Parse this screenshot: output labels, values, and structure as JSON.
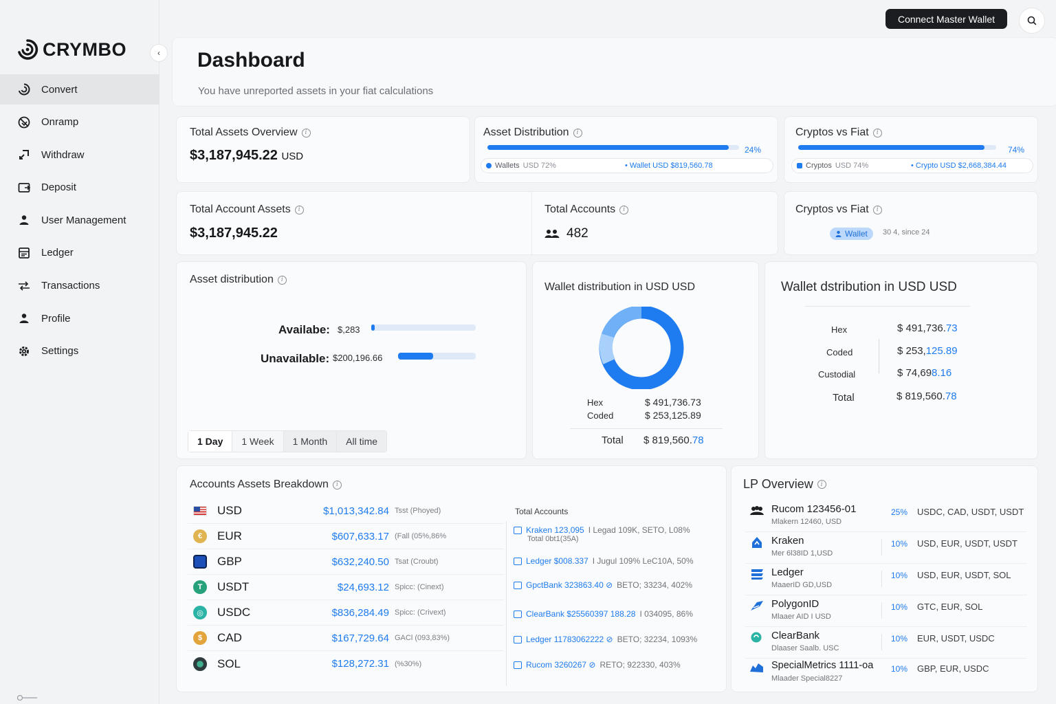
{
  "app": {
    "brand": "CRYMBO"
  },
  "topbar": {
    "connect_label": "Connect Master Wallet"
  },
  "sidebar": {
    "items": [
      {
        "label": "Convert",
        "icon": "convert-icon"
      },
      {
        "label": "Onramp",
        "icon": "onramp-icon"
      },
      {
        "label": "Withdraw",
        "icon": "withdraw-icon"
      },
      {
        "label": "Deposit",
        "icon": "deposit-icon"
      },
      {
        "label": "User Management",
        "icon": "user-icon"
      },
      {
        "label": "Ledger",
        "icon": "ledger-icon"
      },
      {
        "label": "Transactions",
        "icon": "transactions-icon"
      },
      {
        "label": "Profile",
        "icon": "profile-icon"
      },
      {
        "label": "Settings",
        "icon": "gear-icon"
      }
    ]
  },
  "header": {
    "title": "Dashboard",
    "subtitle": "You have unreported assets in your fiat calculations"
  },
  "total_assets": {
    "title": "Total Assets Overview",
    "value": "$3,187,945.22",
    "unit": "USD"
  },
  "asset_dist": {
    "title": "Asset Distribution",
    "pct_label": "24%",
    "fill": 0.96,
    "legend_left": "Wallets",
    "legend_left_unit": "USD 72%",
    "legend_right": "• Wallet USD $819,560.78"
  },
  "crypto_fiat_1": {
    "title": "Cryptos vs Fiat",
    "pct_label": "74%",
    "fill": 0.94,
    "legend_left": "Cryptos",
    "legend_left_unit": "USD 74%",
    "legend_right": "• Crypto USD $2,668,384.44"
  },
  "account_assets": {
    "title": "Total Account Assets",
    "value": "$3,187,945.22"
  },
  "total_accounts": {
    "title": "Total Accounts",
    "value": "482"
  },
  "crypto_fiat_2": {
    "title": "Cryptos vs Fiat",
    "badge": "Wallet",
    "note": "30 4, since 24"
  },
  "asset_distribution": {
    "title": "Asset distribution",
    "available_label": "Availabe:",
    "available_value": "$,283",
    "available_fill": 0.03,
    "unavailable_label": "Unavailable:",
    "unavailable_value": "$200,196.66",
    "unavailable_fill": 0.45,
    "tabs": [
      "1 Day",
      "1 Week",
      "1 Month",
      "All time"
    ]
  },
  "wallet_dist": {
    "title": "Wallet distribution in USD USD",
    "rows": [
      {
        "label": "Hex",
        "value": "$ 491,736.73"
      },
      {
        "label": "Coded",
        "value": "$ 253,125.89"
      }
    ],
    "total_label": "Total",
    "total_main": "$ 819,560.",
    "total_cents": "78"
  },
  "wallet_dist2": {
    "title": "Wallet dstribution in USD USD",
    "rows": [
      {
        "label": "Hex",
        "main": "$ 491,736.",
        "cents": "73"
      },
      {
        "label": "Coded",
        "main": "$ 253,",
        "cents": "125.89"
      },
      {
        "label": "Custodial",
        "main": "$ 74,69",
        "cents": "8.16"
      }
    ],
    "total_label": "Total",
    "total_main": "$ 819,560.",
    "total_cents": "78"
  },
  "breakdown": {
    "title": "Accounts Assets Breakdown",
    "accounts_header": "Total Accounts",
    "rows": [
      {
        "code": "USD",
        "amount": "$1,013,342.84",
        "note": "Tsst (Phoyed)",
        "color": "#d33a3a"
      },
      {
        "code": "EUR",
        "amount": "$607,633.17",
        "note": "(Fall (05%,86%",
        "color": "#e0b451"
      },
      {
        "code": "GBP",
        "amount": "$632,240.50",
        "note": "Tsat (Croubt)",
        "color": "#1d4fb8"
      },
      {
        "code": "USDT",
        "amount": "$24,693.12",
        "note": "Spicc: (Cinext)",
        "color": "#27a17c"
      },
      {
        "code": "USDC",
        "amount": "$836,284.49",
        "note": "Spicc: (Crivext)",
        "color": "#2bb3a5"
      },
      {
        "code": "CAD",
        "amount": "$167,729.64",
        "note": "GACl (093,83%)",
        "color": "#e3a53b"
      },
      {
        "code": "SOL",
        "amount": "$128,272.31",
        "note": "(%30%)",
        "color": "#2e3b3f"
      }
    ],
    "accounts": [
      {
        "main": "Kraken 123,095",
        "grey": "I  Legad 109K, SETO, L08%",
        "sub": "Total 0bt1(35A)"
      },
      {
        "main": "Ledger $008.337",
        "grey": "I  Jugul 109% LeC10A, 50%",
        "sub": ""
      },
      {
        "main": "GpctBank 323863.40 ⊘",
        "grey": "BETO; 33234, 402%",
        "sub": ""
      },
      {
        "main": "ClearBank $25560397 188.28",
        "grey": "I  034095, 86%",
        "sub": ""
      },
      {
        "main": "Ledger 11783062222 ⊘",
        "grey": "BETO; 32234, 1093%",
        "sub": ""
      },
      {
        "main": "Rucom 3260267 ⊘",
        "grey": "RETO; 922330, 403%",
        "sub": ""
      }
    ]
  },
  "lp": {
    "title": "LP Overview",
    "rows": [
      {
        "name": "Rucom 123456-01",
        "sub": "Mlakern 12460, USD",
        "pct": "25%",
        "cur": "USDC,  CAD,  USDT,  USDT",
        "icon": "users-icon"
      },
      {
        "name": "Kraken",
        "sub": "Mer 6l38ID 1,USD",
        "pct": "10%",
        "cur": "USD,  EUR,  USDT,  USDT",
        "icon": "kraken-icon"
      },
      {
        "name": "Ledger",
        "sub": "MaaerID GD,USD",
        "pct": "10%",
        "cur": "USD,  EUR,  USDT,  SOL",
        "icon": "ledger-icon"
      },
      {
        "name": "PolygonID",
        "sub": "Mlaaer AID  I USD",
        "pct": "10%",
        "cur": "GTC,  EUR,  SOL",
        "icon": "polygon-icon"
      },
      {
        "name": "ClearBank",
        "sub": "Dlaaser Saalb. USC",
        "pct": "10%",
        "cur": "EUR,  USDT,  USDC",
        "icon": "clearbank-icon"
      },
      {
        "name": "SpecialMetrics 1111-oa",
        "sub": "Mlaader Special8227",
        "pct": "10%",
        "cur": "GBP,  EUR,  USDC",
        "icon": "specialmetrics-icon"
      }
    ]
  },
  "colors": {
    "accent": "#1e7bf0",
    "dark": "#1b1d21"
  }
}
